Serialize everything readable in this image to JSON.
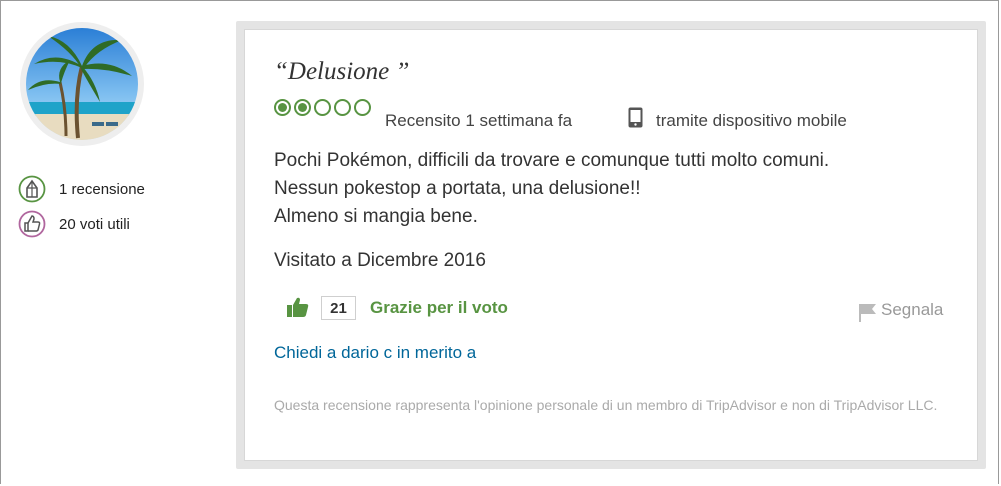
{
  "user": {
    "reviews_count": "1 recensione",
    "helpful_votes": "20 voti utili"
  },
  "review": {
    "title": "“Delusione ”",
    "rating": {
      "value": 2,
      "max": 5
    },
    "reviewed_when": "Recensito 1 settimana fa",
    "via": "tramite dispositivo mobile",
    "body": [
      "Pochi Pokémon, difficili da trovare e comunque tutti molto comuni.",
      "Nessun pokestop a portata, una delusione!!",
      "Almeno si mangia bene."
    ],
    "visited": "Visitato a Dicembre 2016",
    "helpful_count": "21",
    "thanks_label": "Grazie per il voto",
    "report_label": "Segnala",
    "ask_label": "Chiedi a dario c in merito a",
    "disclaimer": "Questa recensione rappresenta l'opinione personale di un membro di TripAdvisor e non di TripAdvisor LLC."
  },
  "colors": {
    "accent_green": "#589442",
    "link_blue": "#006699",
    "muted_gray": "#aaaaaa"
  },
  "icons": [
    "avatar-photo",
    "pencil-icon",
    "thumbs-up-icon",
    "mobile-phone-icon",
    "flag-icon"
  ]
}
